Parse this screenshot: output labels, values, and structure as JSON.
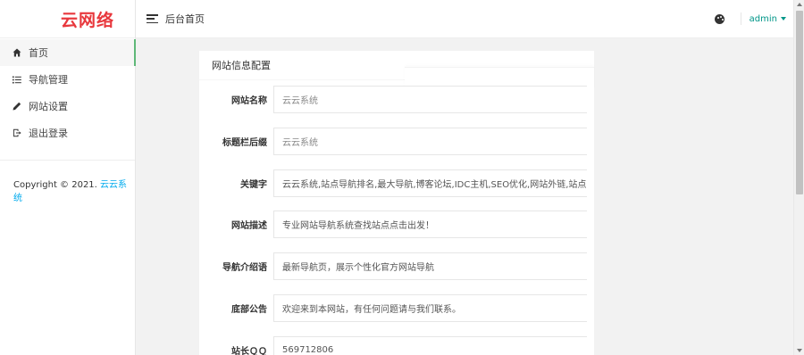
{
  "logo": {
    "text": "云网络"
  },
  "sidebar": {
    "items": [
      {
        "label": "首页",
        "icon": "home-icon"
      },
      {
        "label": "导航管理",
        "icon": "list-icon"
      },
      {
        "label": "网站设置",
        "icon": "pencil-icon"
      },
      {
        "label": "退出登录",
        "icon": "logout-icon"
      }
    ],
    "copyright_prefix": "Copyright © 2021.",
    "copyright_link": "云云系统"
  },
  "header": {
    "title": "后台首页",
    "user": "admin"
  },
  "card": {
    "title": "网站信息配置",
    "fields": [
      {
        "label": "网站名称",
        "value": "云云系统"
      },
      {
        "label": "标题栏后缀",
        "value": "云云系统"
      },
      {
        "label": "关键字",
        "value": "云云系统,站点导航排名,最大导航,博客论坛,IDC主机,SEO优化,网站外链,站点收录,免审"
      },
      {
        "label": "网站描述",
        "value": "专业网站导航系统查找站点点击出发！"
      },
      {
        "label": "导航介绍语",
        "value": "最新导航页，展示个性化官方网站导航"
      },
      {
        "label": "底部公告",
        "value": "欢迎来到本网站，有任何问题请与我们联系。"
      },
      {
        "label": "站长ＱＱ",
        "value": "569712806"
      }
    ]
  },
  "colors": {
    "accent": "#009688",
    "active_bar": "#5fb878",
    "logo": "#e8383d",
    "link": "#01aaed"
  }
}
